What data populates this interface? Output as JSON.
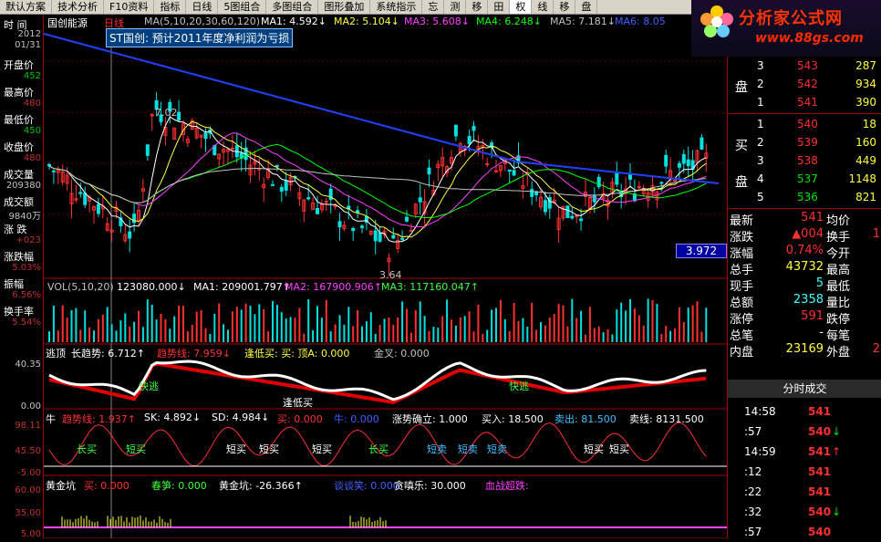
{
  "menu": [
    "默认方案",
    "技术分析",
    "F10资料",
    "指标",
    "日线",
    "5图组合",
    "多图组合",
    "图形叠加",
    "系统指示",
    "忘",
    "测",
    "移",
    "田",
    "权",
    "线",
    "移",
    "盘"
  ],
  "brand": {
    "title": "分析家公式网",
    "url": "www.88gs.com"
  },
  "chart_header": {
    "stock": "国创能源",
    "period": "日线",
    "ma_label": "MA(5,10,20,30,60,120)",
    "ma1": "MA1: 4.592↓",
    "ma2": "MA2: 5.104↓",
    "ma3": "MA3: 5.608↓",
    "ma4": "MA4: 6.248↓",
    "ma5": "MA5: 7.181↓",
    "ma6": "MA6: 8.05"
  },
  "notice": "ST国创: 预计2011年度净利润为亏损",
  "left": {
    "time_label": "时 间",
    "date_year": "2012",
    "date_md": "01/31",
    "open_label": "开盘价",
    "open": "452",
    "high_label": "最高价",
    "high": "480",
    "low_label": "最低价",
    "low": "450",
    "close_label": "收盘价",
    "close": "480",
    "vol_label": "成交量",
    "vol": "209380",
    "amt_label": "成交额",
    "amt": "9840万",
    "chg_label": "涨 跌",
    "chg": "+023",
    "chgpct_label": "涨跌幅",
    "chgpct": "5.03%",
    "amp_label": "振幅",
    "amp": "6.56%",
    "turn_label": "换手率",
    "turn": "5.54%"
  },
  "price_chart": {
    "max_label": "7.02",
    "min_label": "3.64",
    "current_price": "3.972"
  },
  "vol_header": {
    "label": "VOL(5,10,20)",
    "v": "123080.000↓",
    "ma1": "MA1: 209001.797↑",
    "ma2": "MA2: 167900.906↑",
    "ma3": "MA3: 117160.047↑"
  },
  "ind1": {
    "header_a": "逃顶",
    "header_b": "长趋势: 6.712↑",
    "header_c": "趋势线: 7.959↓",
    "header_d": "逢低买: 买: 顶A: 0.000",
    "header_e": "金叉: 0.000",
    "y1": "40.35",
    "y2": "0.00",
    "labels": {
      "kuaitao": "快逃",
      "fengdi": "逢低买",
      "kuaitao2": "快逃"
    }
  },
  "ind2": {
    "header_a": "牛",
    "header_b": "趋势线: 1.937↑",
    "header_c": "SK: 4.892↓",
    "header_d": "SD: 4.984↓",
    "header_e": "买: 0.000",
    "header_f": "牛: 0.000",
    "header_g": "涨势确立: 1.000",
    "header_h": "买入: 18.500",
    "header_i": "卖出: 81.500",
    "header_j": "卖线: 8131.500",
    "y1": "98.11",
    "y2": "45.50",
    "y3": "-5.00",
    "labels": {
      "changmai": "长买",
      "duanmai": "短买",
      "duanmai2": "短买",
      "duanmai3": "短买",
      "changmai2": "长买",
      "duanmai4": "短卖",
      "duanmai5": "短卖",
      "duanmai6": "短卖",
      "duanmai7": "短买",
      "duanmai8": "短买",
      "duanmai9": "短买"
    }
  },
  "ind3": {
    "header_a": "黄金坑",
    "header_b": "买: 0.000",
    "header_c": "春笋: 0.000",
    "header_d": "黄金坑: -26.366↑",
    "header_e": "谈谈笑: 0.000",
    "header_f": "贪嗔乐: 30.000",
    "header_g": "血战超跌:",
    "y1": "60.00",
    "y2": "35.00",
    "y3": "5.00"
  },
  "orderbook": {
    "sell": [
      {
        "label": "",
        "n": "3",
        "p": "543",
        "v": "287"
      },
      {
        "label": "盘",
        "n": "2",
        "p": "542",
        "v": "934"
      },
      {
        "label": "",
        "n": "1",
        "p": "541",
        "v": "390"
      }
    ],
    "buy": [
      {
        "label": "",
        "n": "1",
        "p": "540",
        "v": "18"
      },
      {
        "label": "买",
        "n": "2",
        "p": "539",
        "v": "160"
      },
      {
        "label": "",
        "n": "3",
        "p": "538",
        "v": "449"
      },
      {
        "label": "盘",
        "n": "4",
        "p": "537",
        "v": "1148"
      },
      {
        "label": "",
        "n": "5",
        "p": "536",
        "v": "821"
      }
    ]
  },
  "quote": [
    {
      "k": "最新",
      "v": "541",
      "k2": "均价",
      "v2": ""
    },
    {
      "k": "涨跌",
      "v": "▲004",
      "k2": "换手",
      "v2": "1"
    },
    {
      "k": "涨幅",
      "v": "0.74%",
      "k2": "今开",
      "v2": ""
    },
    {
      "k": "总手",
      "v": "43732",
      "k2": "最高",
      "v2": ""
    },
    {
      "k": "现手",
      "v": "5",
      "k2": "最低",
      "v2": ""
    },
    {
      "k": "总额",
      "v": "2358",
      "k2": "量比",
      "v2": ""
    },
    {
      "k": "涨停",
      "v": "591",
      "k2": "跌停",
      "v2": ""
    },
    {
      "k": "总笔",
      "v": "-",
      "k2": "每笔",
      "v2": ""
    },
    {
      "k": "内盘",
      "v": "23169",
      "k2": "外盘",
      "v2": "2"
    }
  ],
  "trades_title": "分时成交",
  "trades": [
    {
      "t": "14:58",
      "p": "541",
      "a": ""
    },
    {
      "t": ":57",
      "p": "540",
      "a": "↓"
    },
    {
      "t": "14:59",
      "p": "541",
      "a": "↑"
    },
    {
      "t": ":12",
      "p": "541",
      "a": ""
    },
    {
      "t": ":22",
      "p": "541",
      "a": ""
    },
    {
      "t": ":32",
      "p": "540",
      "a": "↓"
    },
    {
      "t": ":57",
      "p": "540",
      "a": ""
    }
  ],
  "colors": {
    "up": "#ff3030",
    "down": "#00e0e0",
    "bg": "#000000",
    "border": "#a00000"
  }
}
